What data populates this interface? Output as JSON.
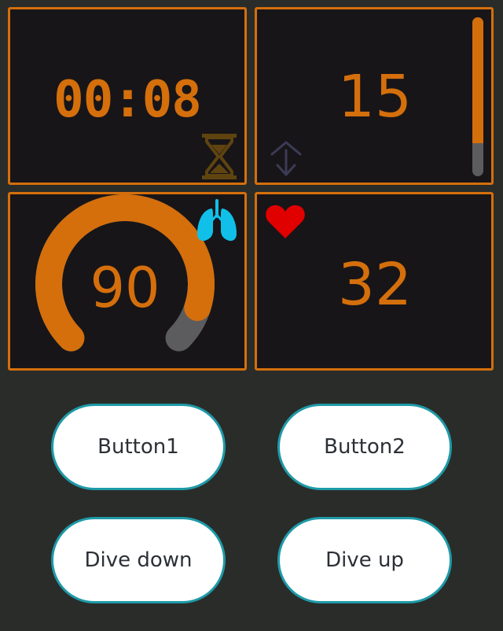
{
  "colors": {
    "background": "#2a2c29",
    "panel_background": "#181518",
    "panel_border": "#d46f0c",
    "value_text": "#d46f0c",
    "track_gray": "#5c5c5e",
    "lungs": "#10c0e8",
    "heart": "#e10000",
    "button_border": "#1e9aa8",
    "button_text": "#2c3036"
  },
  "timer": {
    "value": "00:08",
    "icon": "hourglass-icon"
  },
  "depth": {
    "value": "15",
    "bar_level": 0.79,
    "icon": "ascent-descent-icon"
  },
  "oxygen": {
    "value": "90",
    "gauge_level": 0.9,
    "icon": "lungs-icon"
  },
  "heart_rate": {
    "value": "32",
    "icon": "heart-icon"
  },
  "buttons": {
    "button1": "Button1",
    "button2": "Button2",
    "dive_down": "Dive down",
    "dive_up": "Dive up"
  }
}
